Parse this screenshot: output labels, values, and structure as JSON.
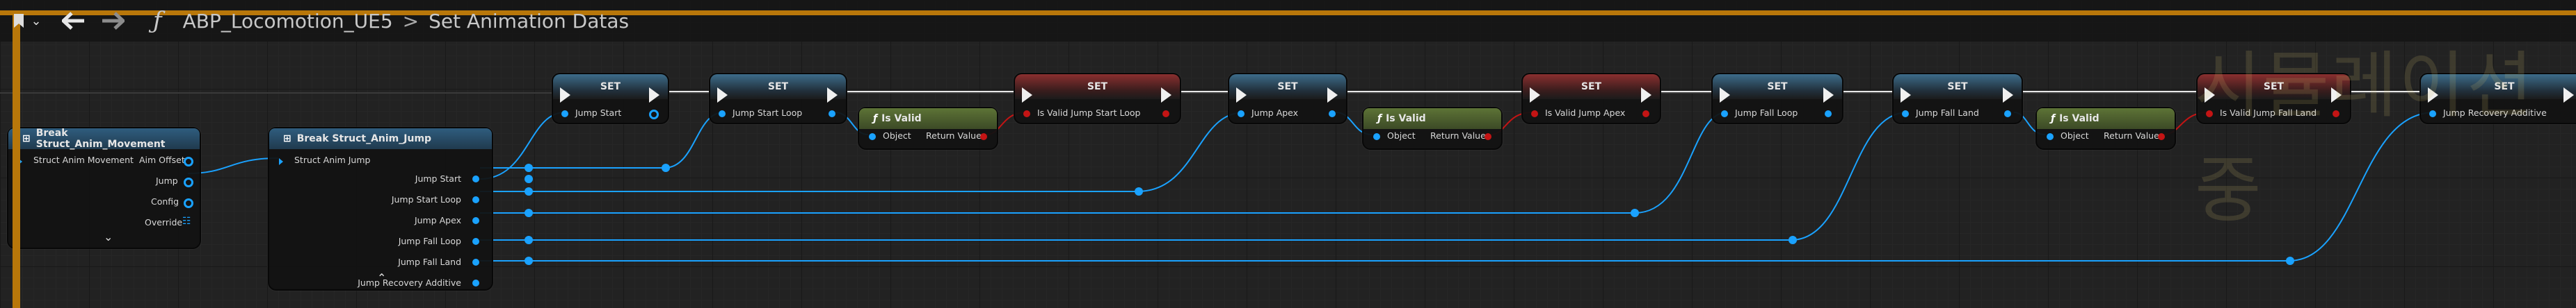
{
  "toolbar": {
    "breadcrumb_blueprint": "ABP_Locomotion_UE5",
    "breadcrumb_separator": ">",
    "breadcrumb_function": "Set Animation Datas",
    "function_icon": "ƒ"
  },
  "watermark": "시뮬레이션중",
  "nodes": {
    "break_movement": {
      "title": "Break Struct_Anim_Movement",
      "input": "Struct Anim Movement",
      "outputs": [
        "Aim Offset",
        "Jump",
        "Config",
        "Override"
      ]
    },
    "break_jump": {
      "title": "Break Struct_Anim_Jump",
      "input": "Struct Anim Jump",
      "outputs": [
        "Jump Start",
        "Jump Start Loop",
        "Jump Apex",
        "Jump Fall Loop",
        "Jump Fall Land",
        "Jump Recovery Additive"
      ]
    },
    "set_title": "SET",
    "set_nodes": [
      {
        "label": "Jump Start",
        "color": "blue"
      },
      {
        "label": "Jump Start Loop",
        "color": "blue"
      },
      {
        "label": "Is Valid Jump Start Loop",
        "color": "red"
      },
      {
        "label": "Jump Apex",
        "color": "blue"
      },
      {
        "label": "Is Valid Jump Apex",
        "color": "red"
      },
      {
        "label": "Jump Fall Loop",
        "color": "blue"
      },
      {
        "label": "Jump Fall Land",
        "color": "blue"
      },
      {
        "label": "Is Valid Jump Fall Land",
        "color": "red"
      },
      {
        "label": "Jump Recovery Additive",
        "color": "blue"
      }
    ],
    "is_valid": {
      "title": "Is Valid",
      "input": "Object",
      "output": "Return Value"
    }
  },
  "colors": {
    "accent_orange": "#b8770a",
    "object_pin": "#1aa2ff",
    "bool_pin": "#c41414",
    "set_header_blue": "#3d6c8a",
    "set_header_red": "#8a2f2f",
    "isvalid_header": "#5d7336"
  },
  "icons": {
    "back": "back-arrow-icon",
    "forward": "forward-arrow-icon",
    "function": "function-icon",
    "break": "break-struct-icon",
    "is_valid": "function-icon"
  }
}
